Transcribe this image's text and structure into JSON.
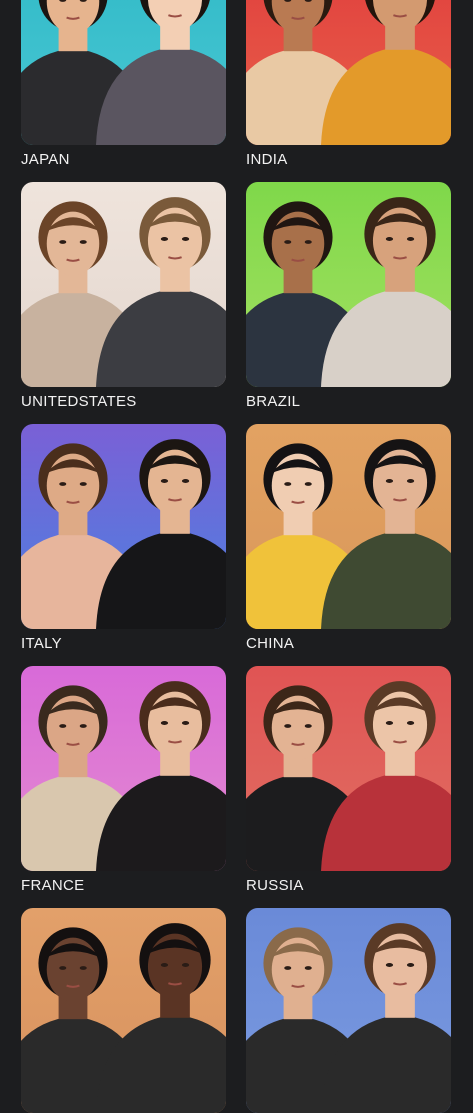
{
  "countries": [
    {
      "label": "JAPAN",
      "bg_top": "#2fb8c6",
      "bg_bottom": "#49c8d4",
      "tone_a": "#e6b48e",
      "tone_b": "#f3cfb4",
      "hair_a": "#1a1512",
      "hair_b": "#1a1410",
      "cloth_a": "#2b2b2e",
      "cloth_b": "#5a5560",
      "partial": false
    },
    {
      "label": "INDIA",
      "bg_top": "#e03c3c",
      "bg_bottom": "#e8604a",
      "tone_a": "#b97a52",
      "tone_b": "#d39a70",
      "hair_a": "#2a1a10",
      "hair_b": "#22140c",
      "cloth_a": "#e9c9a4",
      "cloth_b": "#e39a2a",
      "partial": false
    },
    {
      "label": "UNITEDSTATES",
      "bg_top": "#efe4dc",
      "bg_bottom": "#e3d6ce",
      "tone_a": "#e3b797",
      "tone_b": "#ebc3a4",
      "hair_a": "#6b4428",
      "hair_b": "#7a5a3a",
      "cloth_a": "#c8b29f",
      "cloth_b": "#3c3d42",
      "partial": false
    },
    {
      "label": "BRAZIL",
      "bg_top": "#7fd84a",
      "bg_bottom": "#a4e061",
      "tone_a": "#a8704a",
      "tone_b": "#d7a27c",
      "hair_a": "#201612",
      "hair_b": "#3a2618",
      "cloth_a": "#2c3440",
      "cloth_b": "#d8d0c8",
      "partial": false
    },
    {
      "label": "ITALY",
      "bg_top": "#7a60d6",
      "bg_bottom": "#4b82e0",
      "tone_a": "#deaa86",
      "tone_b": "#e4b592",
      "hair_a": "#4a2e1c",
      "hair_b": "#1c1612",
      "cloth_a": "#e7b59c",
      "cloth_b": "#161618",
      "partial": false
    },
    {
      "label": "CHINA",
      "bg_top": "#e2a262",
      "bg_bottom": "#d9975a",
      "tone_a": "#f0cdb2",
      "tone_b": "#e3b494",
      "hair_a": "#141214",
      "hair_b": "#151314",
      "cloth_a": "#f0c23a",
      "cloth_b": "#3f4a32",
      "partial": false
    },
    {
      "label": "FRANCE",
      "bg_top": "#d86ad8",
      "bg_bottom": "#e48ad0",
      "tone_a": "#dba686",
      "tone_b": "#e8bd9e",
      "hair_a": "#3a2a1e",
      "hair_b": "#4a2c1c",
      "cloth_a": "#d9c7ae",
      "cloth_b": "#1c1a1c",
      "partial": false
    },
    {
      "label": "RUSSIA",
      "bg_top": "#e05454",
      "bg_bottom": "#e06e62",
      "tone_a": "#e3b393",
      "tone_b": "#ecc5a8",
      "hair_a": "#3c2618",
      "hair_b": "#5a3a26",
      "cloth_a": "#1c1c1e",
      "cloth_b": "#b8323a",
      "partial": false
    },
    {
      "label": "",
      "bg_top": "#e2a06a",
      "bg_bottom": "#d8925e",
      "tone_a": "#6a4230",
      "tone_b": "#5a3424",
      "hair_a": "#141010",
      "hair_b": "#141010",
      "cloth_a": "#2a2a2a",
      "cloth_b": "#2a2a2a",
      "partial": true
    },
    {
      "label": "",
      "bg_top": "#6a8ad8",
      "bg_bottom": "#7a9ae0",
      "tone_a": "#e0b090",
      "tone_b": "#e8bca0",
      "hair_a": "#8a6a4a",
      "hair_b": "#5a3a26",
      "cloth_a": "#2a2a2a",
      "cloth_b": "#2a2a2a",
      "partial": true
    }
  ]
}
